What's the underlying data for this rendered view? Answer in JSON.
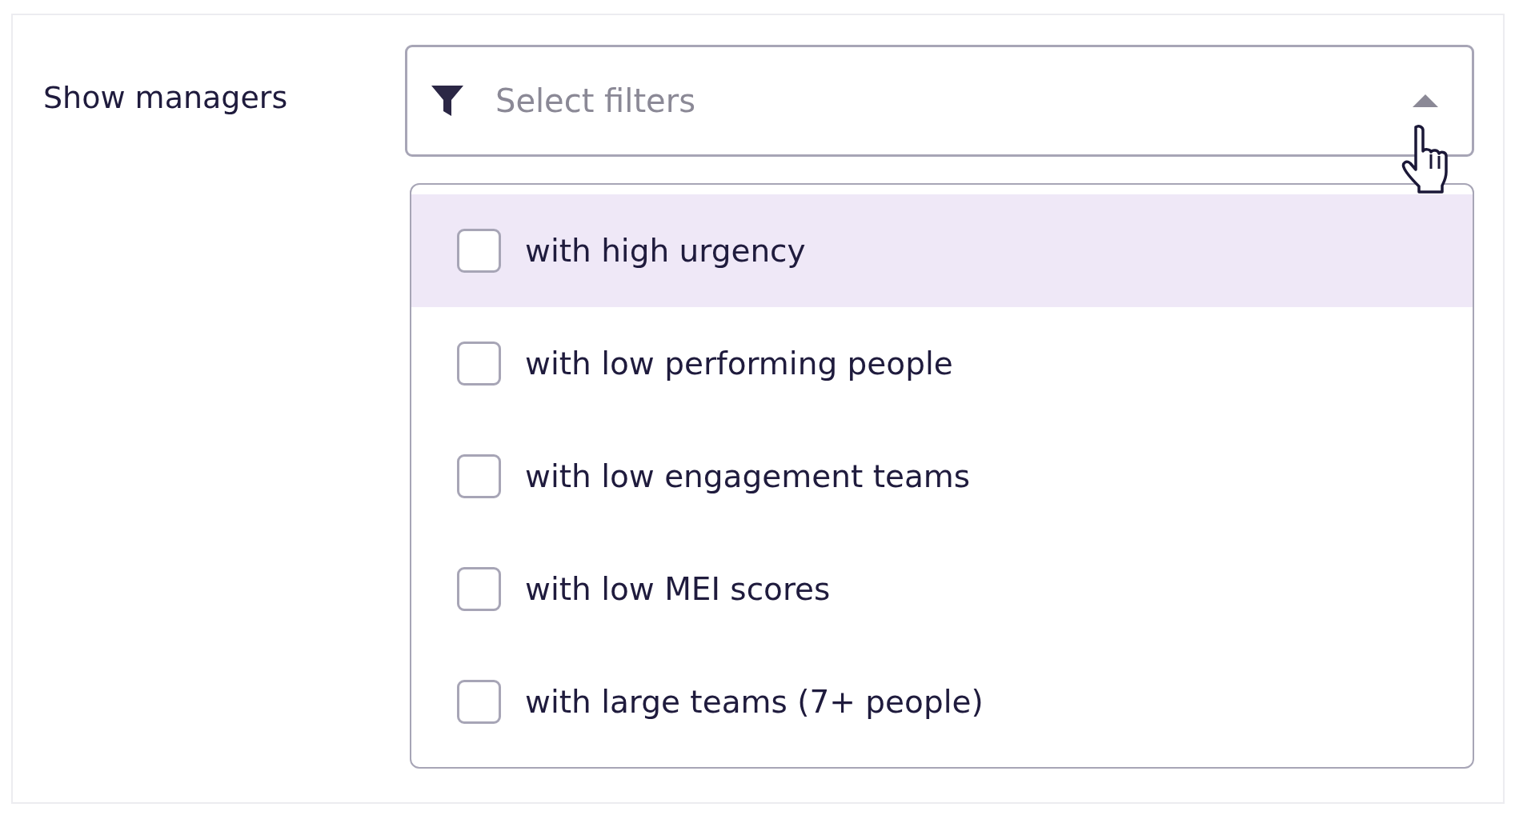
{
  "label": "Show managers",
  "select": {
    "placeholder": "Select filters",
    "expanded": true
  },
  "options": [
    {
      "label": "with high urgency",
      "checked": false,
      "highlighted": true
    },
    {
      "label": "with low performing people",
      "checked": false,
      "highlighted": false
    },
    {
      "label": "with low engagement teams",
      "checked": false,
      "highlighted": false
    },
    {
      "label": "with low MEI scores",
      "checked": false,
      "highlighted": false
    },
    {
      "label": "with large teams (7+ people)",
      "checked": false,
      "highlighted": false
    }
  ]
}
